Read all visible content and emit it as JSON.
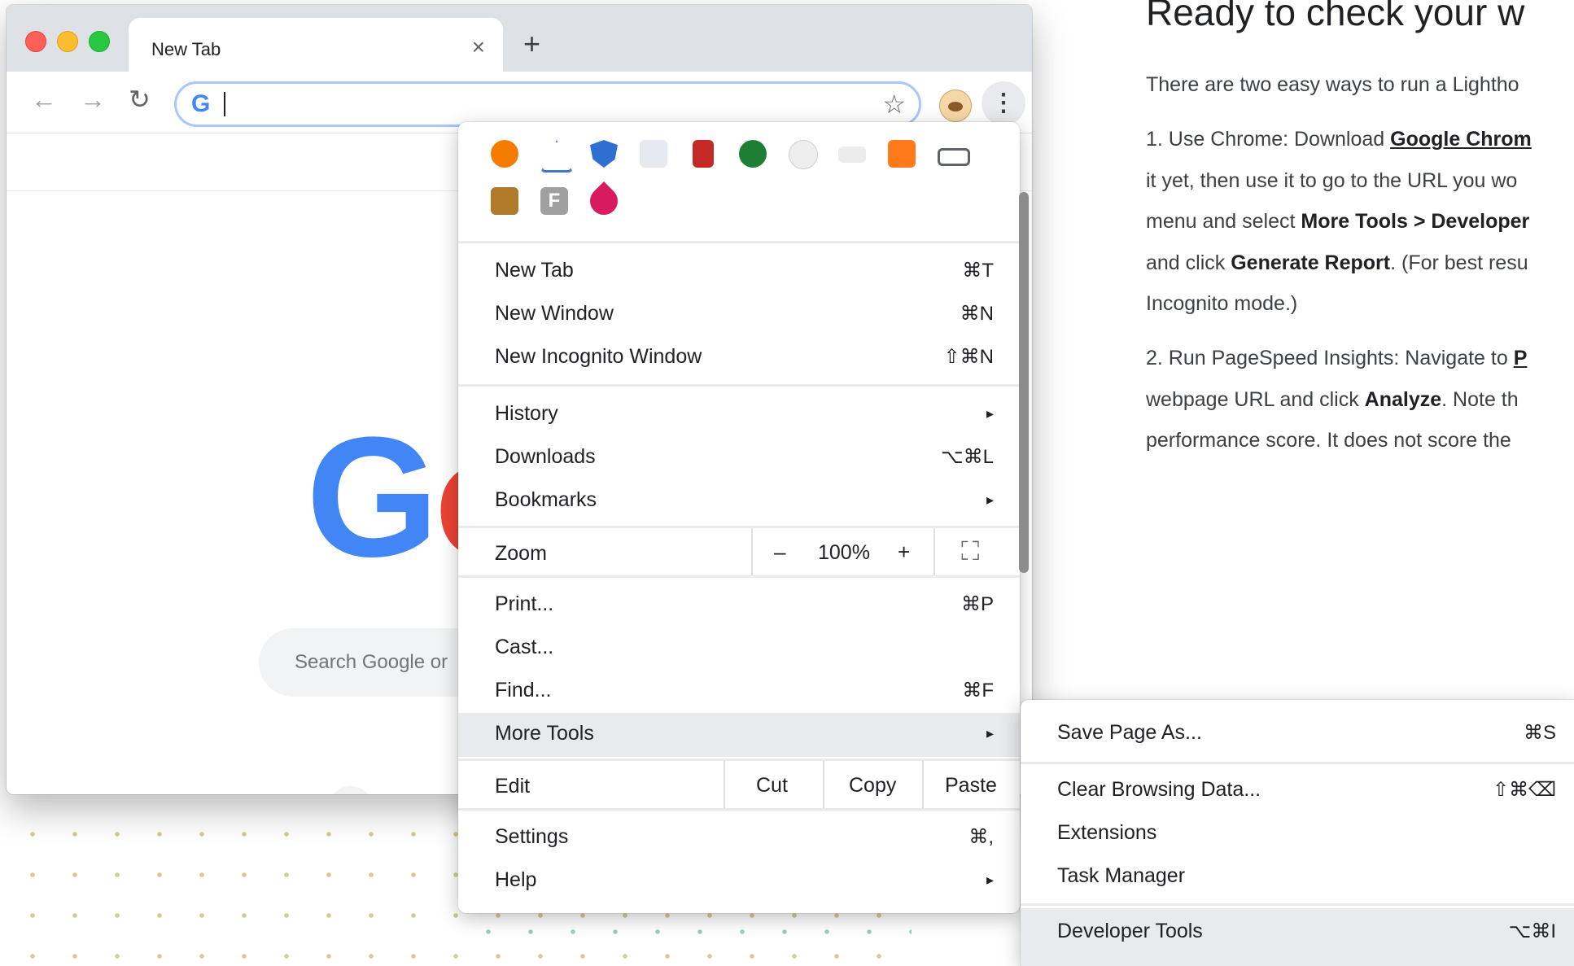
{
  "browser": {
    "tab_title": "New Tab",
    "tab_close": "×",
    "new_tab": "+",
    "back": "←",
    "forward": "→",
    "reload": "↻",
    "omnibox_logo": "G",
    "omnibox_value": "",
    "bookmark_star": "☆",
    "menu_button": "⋮",
    "search_placeholder": "Search Google or",
    "google_logo_partial": [
      "G",
      "o"
    ]
  },
  "extensions": {
    "icons": [
      "keyhole-icon",
      "axe-icon",
      "shield-icon",
      "react-icon",
      "calculator-icon",
      "check-icon",
      "ghost-icon",
      "screen-icon",
      "chart-icon",
      "laptop-icon",
      "book-icon",
      "f-icon",
      "rocket-icon"
    ],
    "colors": [
      "#f57c00",
      "#3f78c8",
      "#2f6fd1",
      "#d0d6e0",
      "#c62828",
      "#1e7e34",
      "#e0e0e0",
      "#e3e3e3",
      "#ff7a1a",
      "#5f6368",
      "#b07a2a",
      "#a0a0a0",
      "#d81b60"
    ],
    "f_letter": "F"
  },
  "menu": {
    "items": [
      {
        "label": "New Tab",
        "shortcut": "⌘T"
      },
      {
        "label": "New Window",
        "shortcut": "⌘N"
      },
      {
        "label": "New Incognito Window",
        "shortcut": "⇧⌘N"
      },
      {
        "label": "History",
        "shortcut": "▸"
      },
      {
        "label": "Downloads",
        "shortcut": "⌥⌘L"
      },
      {
        "label": "Bookmarks",
        "shortcut": "▸"
      },
      {
        "label": "Print...",
        "shortcut": "⌘P"
      },
      {
        "label": "Cast...",
        "shortcut": ""
      },
      {
        "label": "Find...",
        "shortcut": "⌘F"
      },
      {
        "label": "More Tools",
        "shortcut": "▸"
      },
      {
        "label": "Settings",
        "shortcut": "⌘,"
      },
      {
        "label": "Help",
        "shortcut": "▸"
      }
    ],
    "zoom": {
      "label": "Zoom",
      "minus": "–",
      "value": "100%",
      "plus": "+",
      "fullscreen": "⛶"
    },
    "edit": {
      "label": "Edit",
      "cut": "Cut",
      "copy": "Copy",
      "paste": "Paste"
    }
  },
  "submenu": {
    "items": [
      {
        "label": "Save Page As...",
        "shortcut": "⌘S"
      },
      {
        "label": "Clear Browsing Data...",
        "shortcut": "⇧⌘⌫"
      },
      {
        "label": "Extensions",
        "shortcut": ""
      },
      {
        "label": "Task Manager",
        "shortcut": ""
      },
      {
        "label": "Developer Tools",
        "shortcut": "⌥⌘I"
      }
    ]
  },
  "article": {
    "heading": "Ready to check your w",
    "p0": "There are two easy ways to run a Lightho",
    "p1a": "1. Use Chrome: Download ",
    "p1link": "Google Chrom",
    "p1b": "it yet, then use it to go to the URL you wo",
    "p1c_pre": "menu and select ",
    "p1c_bold": "More Tools > Developer",
    "p1d_pre": "and click ",
    "p1d_bold": "Generate Report",
    "p1d_post": ". (For best resu",
    "p1e": "Incognito mode.)",
    "p2a": "2. Run PageSpeed Insights: Navigate to ",
    "p2link": "P",
    "p2b_pre": "webpage URL and click ",
    "p2b_bold": "Analyze",
    "p2b_post": ". Note th",
    "p2c": "performance score. It does not score the "
  }
}
